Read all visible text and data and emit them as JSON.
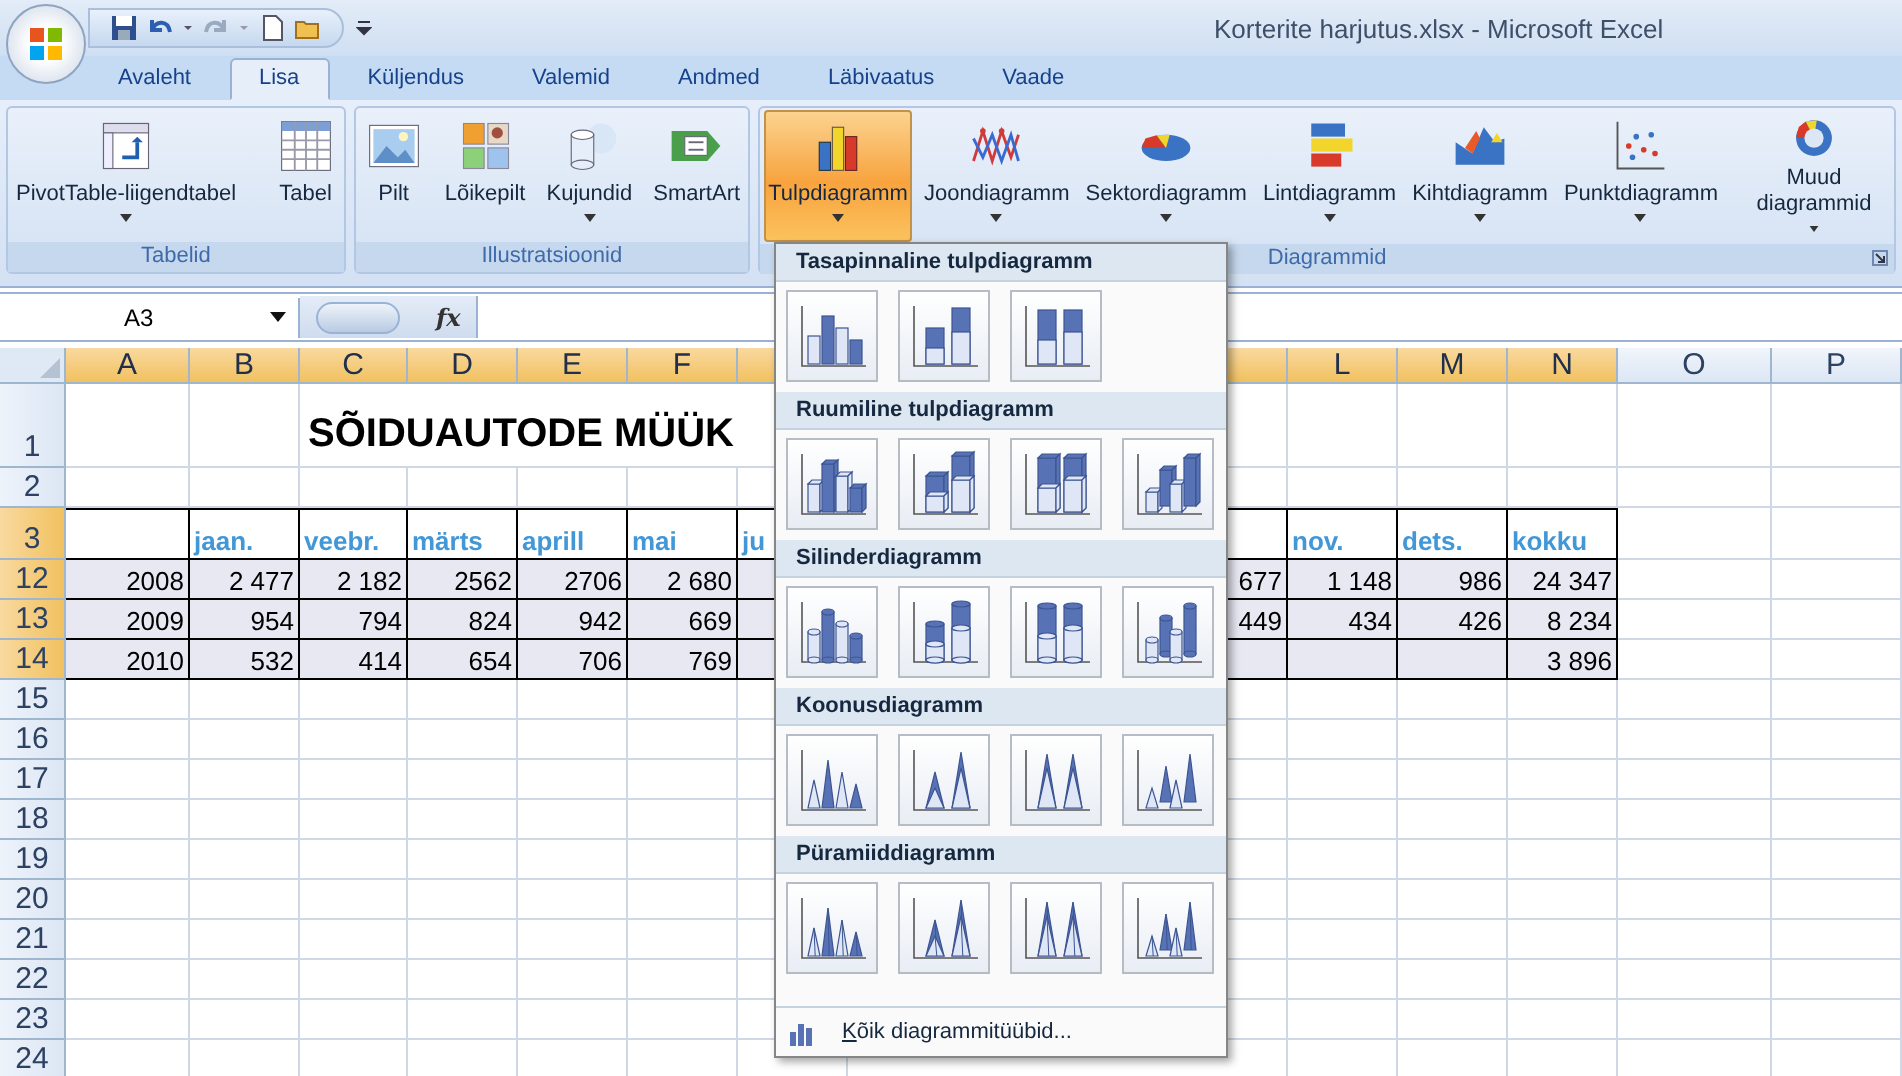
{
  "window": {
    "title": "Korterite harjutus.xlsx - Microsoft Excel"
  },
  "tabs": [
    {
      "label": "Avaleht",
      "selected": false
    },
    {
      "label": "Lisa",
      "selected": true
    },
    {
      "label": "Küljendus",
      "selected": false
    },
    {
      "label": "Valemid",
      "selected": false
    },
    {
      "label": "Andmed",
      "selected": false
    },
    {
      "label": "Läbivaatus",
      "selected": false
    },
    {
      "label": "Vaade",
      "selected": false
    }
  ],
  "ribbon": {
    "groups": [
      {
        "label": "Tabelid",
        "buttons": [
          {
            "label": "PivotTable-liigendtabel",
            "has_menu": true,
            "selected": false
          },
          {
            "label": "Tabel",
            "has_menu": false,
            "selected": false
          }
        ]
      },
      {
        "label": "Illustratsioonid",
        "buttons": [
          {
            "label": "Pilt",
            "has_menu": false,
            "selected": false
          },
          {
            "label": "Lõikepilt",
            "has_menu": false,
            "selected": false
          },
          {
            "label": "Kujundid",
            "has_menu": true,
            "selected": false
          },
          {
            "label": "SmartArt",
            "has_menu": false,
            "selected": false
          }
        ]
      },
      {
        "label": "Diagrammid",
        "buttons": [
          {
            "label": "Tulpdiagramm",
            "has_menu": true,
            "selected": true
          },
          {
            "label": "Joondiagramm",
            "has_menu": true,
            "selected": false
          },
          {
            "label": "Sektordiagramm",
            "has_menu": true,
            "selected": false
          },
          {
            "label": "Lintdiagramm",
            "has_menu": true,
            "selected": false
          },
          {
            "label": "Kihtdiagramm",
            "has_menu": true,
            "selected": false
          },
          {
            "label": "Punktdiagramm",
            "has_menu": true,
            "selected": false
          },
          {
            "label": "Muud diagrammid",
            "has_menu": true,
            "selected": false
          }
        ]
      }
    ]
  },
  "formula_bar": {
    "name_box": "A3",
    "fx": "fx"
  },
  "columns": [
    {
      "letter": "A",
      "selected": true
    },
    {
      "letter": "B",
      "selected": true
    },
    {
      "letter": "C",
      "selected": true
    },
    {
      "letter": "D",
      "selected": true
    },
    {
      "letter": "E",
      "selected": true
    },
    {
      "letter": "F",
      "selected": true
    },
    {
      "selected": true
    },
    {
      "selected": true
    },
    {
      "letter": "L",
      "selected": true
    },
    {
      "letter": "M",
      "selected": true
    },
    {
      "letter": "N",
      "selected": true
    },
    {
      "letter": "O",
      "selected": false
    },
    {
      "letter": "P",
      "selected": false
    }
  ],
  "rows": [
    {
      "number": "1",
      "selected": false,
      "kind": "title",
      "cells": [
        null,
        null,
        "SÕIDUAUTODE MÜÜK"
      ]
    },
    {
      "number": "2",
      "selected": false,
      "kind": "plain"
    },
    {
      "number": "3",
      "selected": true,
      "kind": "header",
      "cells": [
        null,
        "jaan.",
        "veebr.",
        "märts",
        "aprill",
        "mai",
        "ju",
        null,
        "nov.",
        "dets.",
        "kokku"
      ]
    },
    {
      "number": "12",
      "selected": true,
      "kind": "data",
      "cells": [
        "2008",
        "2 477",
        "2 182",
        "2562",
        "2706",
        "2 680",
        null,
        "677",
        "1 148",
        "986",
        "24 347"
      ]
    },
    {
      "number": "13",
      "selected": true,
      "kind": "data",
      "cells": [
        "2009",
        "954",
        "794",
        "824",
        "942",
        "669",
        null,
        "449",
        "434",
        "426",
        "8 234"
      ]
    },
    {
      "number": "14",
      "selected": true,
      "kind": "data",
      "cells": [
        "2010",
        "532",
        "414",
        "654",
        "706",
        "769",
        null,
        null,
        null,
        null,
        "3 896"
      ]
    },
    {
      "number": "15",
      "selected": false,
      "kind": "plain"
    },
    {
      "number": "16",
      "selected": false,
      "kind": "plain"
    },
    {
      "number": "17",
      "selected": false,
      "kind": "plain"
    },
    {
      "number": "18",
      "selected": false,
      "kind": "plain"
    },
    {
      "number": "19",
      "selected": false,
      "kind": "plain"
    },
    {
      "number": "20",
      "selected": false,
      "kind": "plain"
    },
    {
      "number": "21",
      "selected": false,
      "kind": "plain"
    },
    {
      "number": "22",
      "selected": false,
      "kind": "plain"
    },
    {
      "number": "23",
      "selected": false,
      "kind": "plain"
    },
    {
      "number": "24",
      "selected": false,
      "kind": "plain"
    }
  ],
  "chart_menu": {
    "sections": [
      {
        "title": "Tasapinnaline tulpdiagramm",
        "kind": "flat",
        "options": [
          {
            "selected": false
          },
          {
            "selected": false
          },
          {
            "selected": false
          }
        ]
      },
      {
        "title": "Ruumiline tulpdiagramm",
        "kind": "box",
        "options": [
          {
            "selected": false
          },
          {
            "selected": false
          },
          {
            "selected": false
          },
          {
            "selected": false
          }
        ]
      },
      {
        "title": "Silinderdiagramm",
        "kind": "cylinder",
        "options": [
          {
            "selected": false
          },
          {
            "selected": false
          },
          {
            "selected": false
          },
          {
            "selected": false
          }
        ]
      },
      {
        "title": "Koonusdiagramm",
        "kind": "cone",
        "options": [
          {
            "selected": false
          },
          {
            "selected": false
          },
          {
            "selected": false
          },
          {
            "selected": false
          }
        ]
      },
      {
        "title": "Püramiiddiagramm",
        "kind": "pyramid",
        "options": [
          {
            "selected": false
          },
          {
            "selected": false
          },
          {
            "selected": false
          },
          {
            "selected": false
          }
        ]
      }
    ],
    "footer": "Kõik diagrammitüübid..."
  }
}
